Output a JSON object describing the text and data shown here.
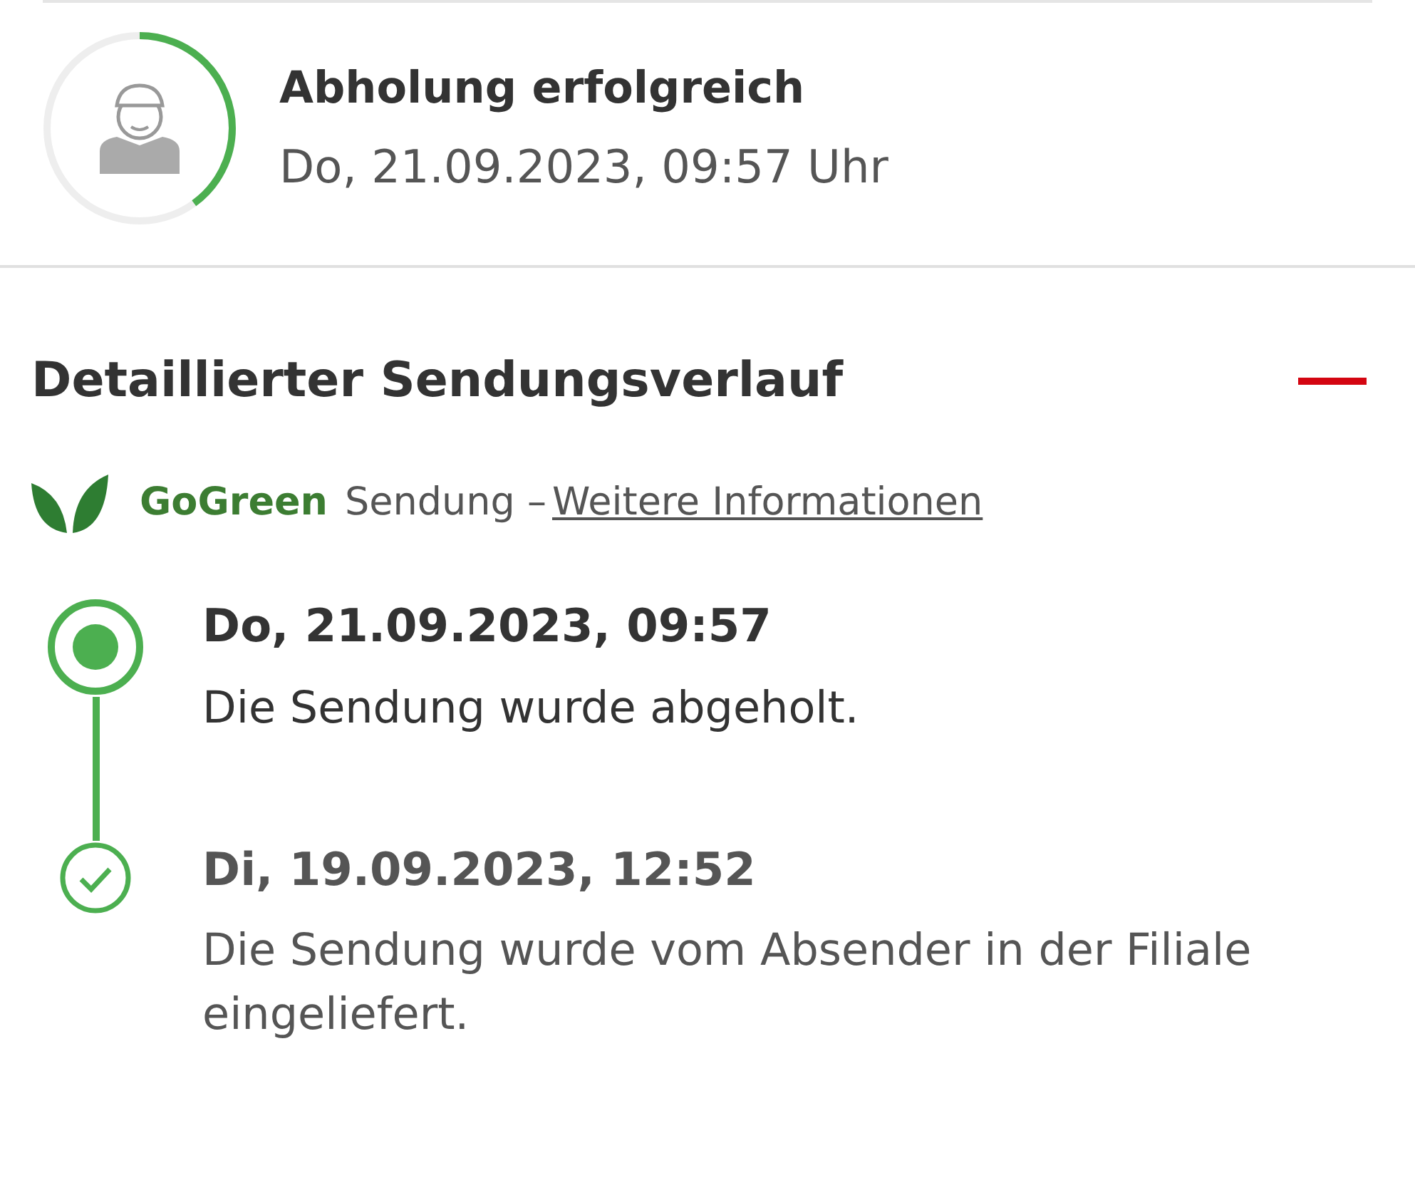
{
  "status": {
    "title": "Abholung erfolgreich",
    "time": "Do, 21.09.2023, 09:57 Uhr"
  },
  "history": {
    "title": "Detaillierter Sendungsverlauf",
    "expanded": true,
    "gogreen": {
      "brand": "GoGreen",
      "text": "Sendung –",
      "link": "Weitere Informationen"
    },
    "events": [
      {
        "kind": "current",
        "time": "Do, 21.09.2023, 09:57",
        "text": "Die Sendung wurde abgeholt."
      },
      {
        "kind": "done",
        "time": "Di, 19.09.2023, 12:52",
        "text": "Die Sendung wurde vom Absender in der Filiale eingeliefert."
      }
    ]
  }
}
